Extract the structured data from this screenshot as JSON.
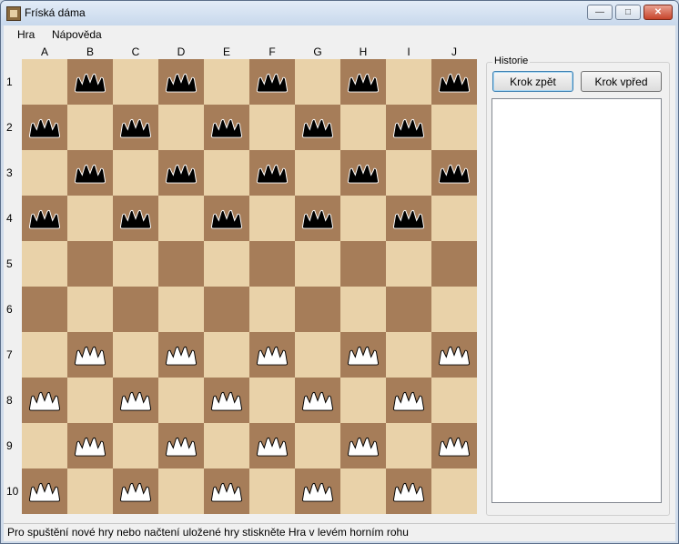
{
  "window": {
    "title": "Fríská dáma",
    "controls": [
      "—",
      "□",
      "✕"
    ]
  },
  "menu": [
    "Hra",
    "Nápověda"
  ],
  "board": {
    "columns": [
      "A",
      "B",
      "C",
      "D",
      "E",
      "F",
      "G",
      "H",
      "I",
      "J"
    ],
    "rows": [
      "1",
      "2",
      "3",
      "4",
      "5",
      "6",
      "7",
      "8",
      "9",
      "10"
    ],
    "colors": {
      "light": "#e9d2a9",
      "dark": "#a67d59",
      "black_piece": "#000000",
      "white_piece": "#ffffff"
    },
    "layout": [
      ".b.b.b.b.b",
      "b.b.b.b.b.",
      ".b.b.b.b.b",
      "b.b.b.b.b.",
      "..........",
      "..........",
      ".w.w.w.w.w",
      "w.w.w.w.w.",
      ".w.w.w.w.w",
      "w.w.w.w.w."
    ]
  },
  "history": {
    "group_label": "Historie",
    "back_label": "Krok zpět",
    "forward_label": "Krok vpřed",
    "items": []
  },
  "status": {
    "text": "Pro spuštění nové hry nebo načtení uložené hry stiskněte Hra v levém horním rohu"
  }
}
